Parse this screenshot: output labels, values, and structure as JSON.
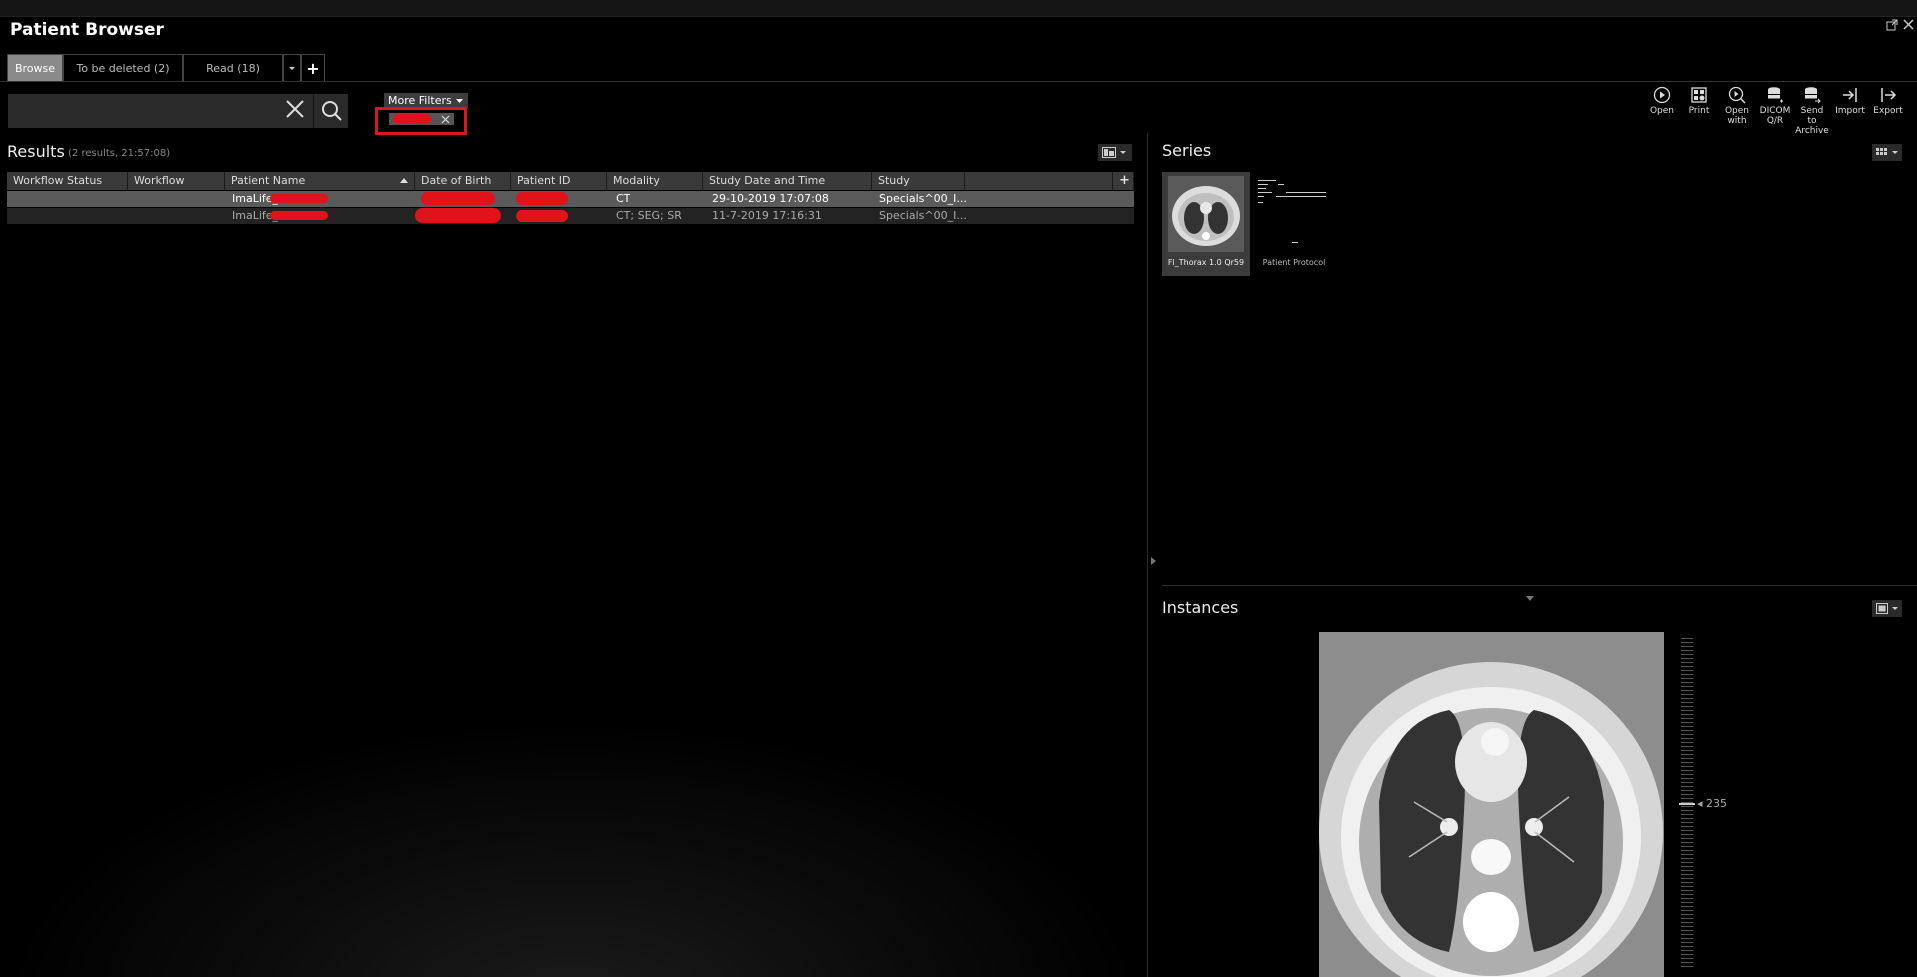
{
  "app": {
    "title": "Patient Browser"
  },
  "tabs": [
    {
      "label": "Browse",
      "active": true
    },
    {
      "label": "To be deleted  (2)",
      "active": false
    },
    {
      "label": "Read  (18)",
      "active": false
    }
  ],
  "search": {
    "value": "",
    "placeholder": ""
  },
  "filters": {
    "more_label": "More Filters"
  },
  "toolbar": [
    {
      "label": "Open",
      "icon": "play-icon"
    },
    {
      "label": "Print",
      "icon": "print-icon"
    },
    {
      "label": "Open with",
      "icon": "open-with-icon"
    },
    {
      "label": "DICOM Q/R",
      "icon": "database-icon"
    },
    {
      "label": "Send to Archive",
      "icon": "archive-icon"
    },
    {
      "label": "Import",
      "icon": "import-icon"
    },
    {
      "label": "Export",
      "icon": "export-icon"
    }
  ],
  "results": {
    "title": "Results",
    "meta": "(2 results, 21:57:08)",
    "columns": [
      "Workflow Status",
      "Workflow Desc...",
      "Patient Name",
      "Date of Birth",
      "Patient ID",
      "Modality",
      "Study Date and Time",
      "Study Descripti..."
    ],
    "rows": [
      {
        "workflow_status": "",
        "workflow_desc": "",
        "patient_name": "ImaLife_",
        "dob": "",
        "patient_id": "",
        "modality": "CT",
        "study_datetime": "29-10-2019 17:07:08",
        "study_desc": "Specials^00_I..."
      },
      {
        "workflow_status": "",
        "workflow_desc": "",
        "patient_name": "ImaLife_",
        "dob": "",
        "patient_id": "",
        "modality": "CT; SEG; SR",
        "study_datetime": "11-7-2019 17:16:31",
        "study_desc": "Specials^00_I..."
      }
    ]
  },
  "series": {
    "title": "Series",
    "items": [
      {
        "label": "Fl_Thorax 1.0 Qr59"
      },
      {
        "label": "Patient Protocol"
      }
    ]
  },
  "instances": {
    "title": "Instances",
    "slider_value": "235"
  },
  "colors": {
    "highlight": "#d8181b",
    "redaction": "#e0121a",
    "active_tab": "#8a8a8a"
  }
}
